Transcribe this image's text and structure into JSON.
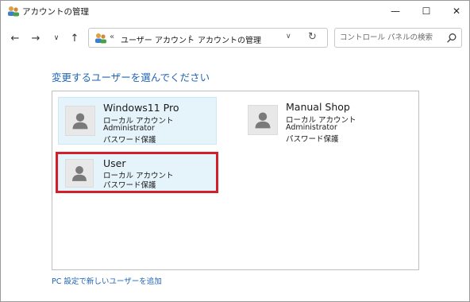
{
  "window": {
    "title": "アカウントの管理",
    "controls": {
      "minimize": "—",
      "maximize": "☐",
      "close": "✕"
    }
  },
  "nav": {
    "back": "←",
    "forward": "→",
    "recent": "∨",
    "up": "↑"
  },
  "address": {
    "overflow": "«",
    "crumbs": [
      "ユーザー アカウント",
      "アカウントの管理"
    ],
    "separator": "›",
    "dropdown": "∨",
    "refresh": "↻"
  },
  "search": {
    "placeholder": "コントロール パネルの検索"
  },
  "main": {
    "heading": "変更するユーザーを選んでください",
    "accounts": [
      {
        "name": "Windows11 Pro",
        "type": "ローカル アカウント",
        "role": "Administrator",
        "protection": "パスワード保護"
      },
      {
        "name": "Manual Shop",
        "type": "ローカル アカウント",
        "role": "Administrator",
        "protection": "パスワード保護"
      },
      {
        "name": "User",
        "type": "ローカル アカウント",
        "protection": "パスワード保護"
      }
    ],
    "add_user_link": "PC 設定で新しいユーザーを追加"
  },
  "colors": {
    "accent": "#1e64b4",
    "highlight": "#e5f3fb",
    "selection": "#d21f2a"
  }
}
